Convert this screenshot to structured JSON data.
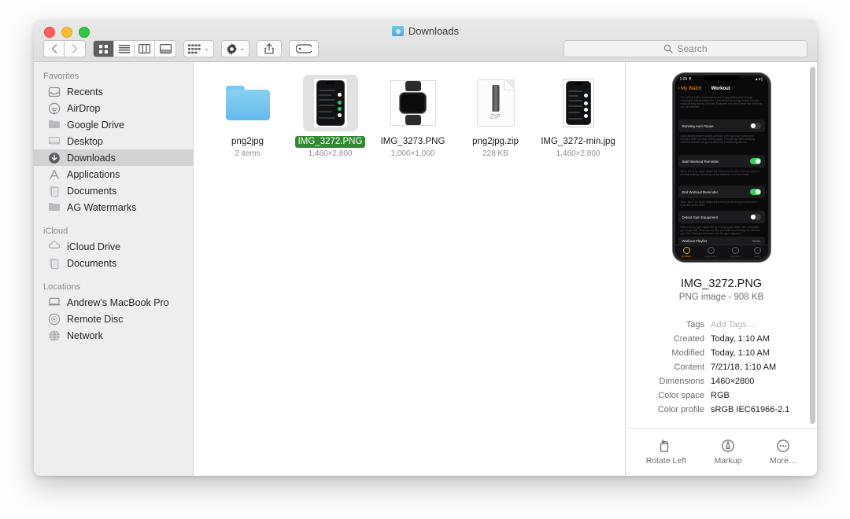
{
  "window": {
    "title": "Downloads",
    "title_icon": "downloads-folder-icon"
  },
  "toolbar": {
    "back_icon": "chevron-left-icon",
    "forward_icon": "chevron-right-icon",
    "view_modes": [
      {
        "name": "icon-view",
        "icon": "grid-icon",
        "active": true
      },
      {
        "name": "list-view",
        "icon": "list-icon",
        "active": false
      },
      {
        "name": "column-view",
        "icon": "columns-icon",
        "active": false
      },
      {
        "name": "gallery-view",
        "icon": "gallery-icon",
        "active": false
      }
    ],
    "group_button": {
      "icon": "arrange-grid-icon",
      "chevron": "⌄"
    },
    "action_button": {
      "icon": "gear-icon",
      "chevron": "⌄"
    },
    "share_button": {
      "icon": "share-icon"
    },
    "tags_button": {
      "icon": "tag-icon"
    },
    "search": {
      "placeholder": "Search",
      "icon": "search-icon",
      "value": ""
    }
  },
  "sidebar": {
    "sections": [
      {
        "header": "Favorites",
        "items": [
          {
            "label": "Recents",
            "icon": "recents-icon",
            "selected": false
          },
          {
            "label": "AirDrop",
            "icon": "airdrop-icon",
            "selected": false
          },
          {
            "label": "Google Drive",
            "icon": "folder-icon",
            "selected": false
          },
          {
            "label": "Desktop",
            "icon": "desktop-icon",
            "selected": false
          },
          {
            "label": "Downloads",
            "icon": "downloads-icon",
            "selected": true
          },
          {
            "label": "Applications",
            "icon": "applications-icon",
            "selected": false
          },
          {
            "label": "Documents",
            "icon": "documents-icon",
            "selected": false
          },
          {
            "label": "AG Watermarks",
            "icon": "folder-icon",
            "selected": false
          }
        ]
      },
      {
        "header": "iCloud",
        "items": [
          {
            "label": "iCloud Drive",
            "icon": "cloud-icon",
            "selected": false
          },
          {
            "label": "Documents",
            "icon": "documents-icon",
            "selected": false
          }
        ]
      },
      {
        "header": "Locations",
        "items": [
          {
            "label": "Andrew’s MacBook Pro",
            "icon": "laptop-icon",
            "selected": false
          },
          {
            "label": "Remote Disc",
            "icon": "disc-icon",
            "selected": false
          },
          {
            "label": "Network",
            "icon": "network-icon",
            "selected": false
          }
        ]
      }
    ]
  },
  "files": [
    {
      "name": "png2jpg",
      "meta": "2 items",
      "kind": "folder",
      "selected": false,
      "tagged": false
    },
    {
      "name": "IMG_3272.PNG",
      "meta": "1,460×2,800",
      "kind": "iphone-screenshot",
      "selected": true,
      "tagged": true,
      "tag_color": "#2f8a2f"
    },
    {
      "name": "IMG_3273.PNG",
      "meta": "1,000×1,000",
      "kind": "watch-image",
      "selected": false,
      "tagged": false
    },
    {
      "name": "png2jpg.zip",
      "meta": "228 KB",
      "kind": "zip",
      "zip_label": "ZIP",
      "selected": false,
      "tagged": false
    },
    {
      "name": "IMG_3272-min.jpg",
      "meta": "1,460×2,800",
      "kind": "iphone-screenshot",
      "selected": false,
      "tagged": false
    }
  ],
  "preview": {
    "title": "IMG_3272.PNG",
    "subtitle": "PNG image - 908 KB",
    "metadata": [
      {
        "key": "Tags",
        "value": "Add Tags…",
        "placeholder": true
      },
      {
        "key": "Created",
        "value": "Today, 1:10 AM",
        "placeholder": false
      },
      {
        "key": "Modified",
        "value": "Today, 1:10 AM",
        "placeholder": false
      },
      {
        "key": "Content",
        "value": "7/21/18, 1:10 AM",
        "placeholder": false
      },
      {
        "key": "Dimensions",
        "value": "1460×2800",
        "placeholder": false
      },
      {
        "key": "Color space",
        "value": "RGB",
        "placeholder": false
      },
      {
        "key": "Color profile",
        "value": "sRGB IEC61966-2.1",
        "placeholder": false
      }
    ],
    "actions": [
      {
        "label": "Rotate Left",
        "icon": "rotate-left-icon"
      },
      {
        "label": "Markup",
        "icon": "markup-icon"
      },
      {
        "label": "More…",
        "icon": "more-icon"
      }
    ],
    "image_content": {
      "status_time": "1:09 ❣",
      "back_label": "My Watch",
      "nav_title": "Workout",
      "top_desc": "Turn off this built-in heart rate sensor during walking and running workouts to extend battery life. Calculations for energy burned or water workouts may be less accurate. Measures compound heart rate detection and use different.",
      "cells": [
        {
          "label": "Running Auto Pause",
          "toggle": "off",
          "desc": "Automatically pauses activity workouts when you stop moving and resumes when you start moving again. This will also affect tracking workouts that are being undertaken by a monitoring interval."
        },
        {
          "label": "Start Workout Reminder",
          "toggle": "on",
          "desc": "When this is on, Apple Watch will remind you to start a workout if you’re running, walking, swimming, on the elliptical, or on Pool Swim."
        },
        {
          "label": "End Workout Reminder",
          "toggle": "on",
          "desc": "When this is on, Apple Watch will remind you to end your workout if it looks like you’re done."
        },
        {
          "label": "Detect Gym Equipment",
          "toggle": "off",
          "desc": "Detect nearby gym equipment by holding Apple Watch near compatible gym equipment. When you do this, your Watch is receiving the Workout app, then Sharing needs learn how the gym equipment."
        }
      ],
      "playlist_label": "Workout Playlist",
      "playlist_value": "None",
      "tabs": [
        {
          "label": "My Watch",
          "active": true
        },
        {
          "label": "Face Gallery",
          "active": false
        },
        {
          "label": "App Store",
          "active": false
        },
        {
          "label": "Search",
          "active": false
        }
      ]
    }
  }
}
